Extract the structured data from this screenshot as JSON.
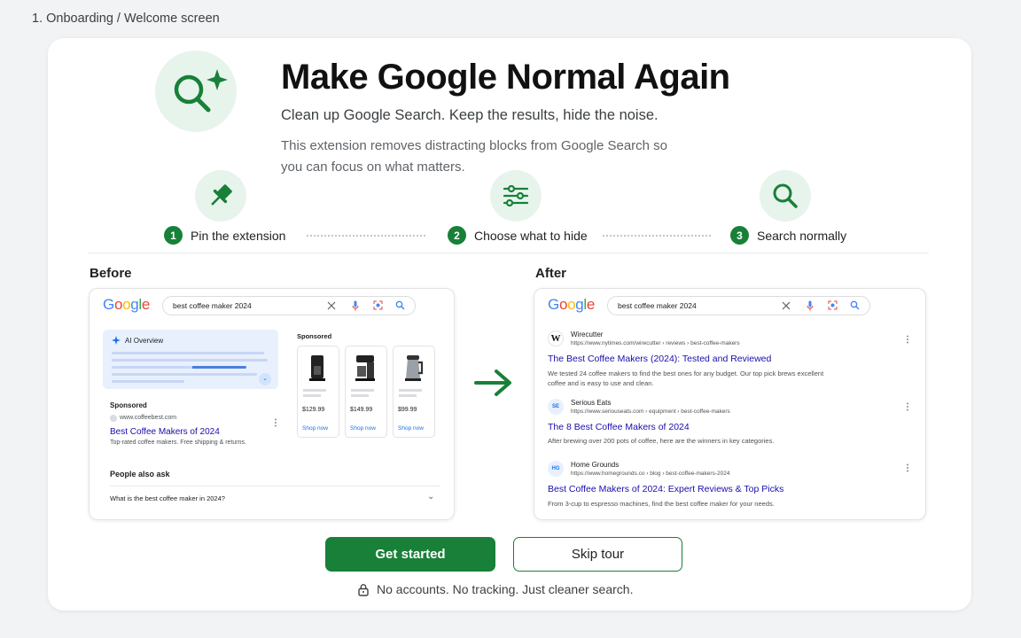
{
  "screen_label": "1. Onboarding / Welcome screen",
  "hero": {
    "title": "Make Google Normal Again",
    "subtitle": "Clean up Google Search. Keep the results, hide the noise.",
    "description": "This extension removes distracting blocks from Google Search so you can focus on what matters.",
    "icon": "search-sparkle-icon"
  },
  "steps": [
    {
      "number": "1",
      "label": "Pin the extension",
      "icon": "pin-icon"
    },
    {
      "number": "2",
      "label": "Choose what to hide",
      "icon": "sliders-icon"
    },
    {
      "number": "3",
      "label": "Search normally",
      "icon": "search-icon"
    }
  ],
  "before": {
    "label": "Before",
    "query": "best coffee maker 2024",
    "ai_overview_label": "AI Overview",
    "sponsored_label": "Sponsored",
    "ad": {
      "sponsored": "Sponsored",
      "url": "www.coffeebest.com",
      "title": "Best Coffee Makers of 2024",
      "snippet": "Top-rated coffee makers. Free shipping & returns."
    },
    "products": [
      {
        "price": "$129.99",
        "cta": "Shop now"
      },
      {
        "price": "$149.99",
        "cta": "Shop now"
      },
      {
        "price": "$99.99",
        "cta": "Shop now"
      }
    ],
    "paa_title": "People also ask",
    "paa_question": "What is the best coffee maker in 2024?"
  },
  "after": {
    "label": "After",
    "query": "best coffee maker 2024",
    "results": [
      {
        "site": "Wirecutter",
        "favicon": "W",
        "url": "https://www.nytimes.com/wirecutter › reviews › best-coffee-makers",
        "title": "The Best Coffee Makers (2024): Tested and Reviewed",
        "snippet": "We tested 24 coffee makers to find the best ones for any budget. Our top pick brews excellent coffee and is easy to use and clean."
      },
      {
        "site": "Serious Eats",
        "favicon": "SE",
        "url": "https://www.seriouseats.com › equipment › best-coffee-makers",
        "title": "The 8 Best Coffee Makers of 2024",
        "snippet": "After brewing over 200 pots of coffee, here are the winners in key categories."
      },
      {
        "site": "Home Grounds",
        "favicon": "HG",
        "url": "https://www.homegrounds.co › blog › best-coffee-makers-2024",
        "title": "Best Coffee Makers of 2024: Expert Reviews & Top Picks",
        "snippet": "From 3-cup to espresso machines, find the best coffee maker for your needs."
      }
    ]
  },
  "buttons": {
    "primary": "Get started",
    "secondary": "Skip tour"
  },
  "privacy_note": "No accounts. No tracking. Just cleaner search.",
  "colors": {
    "accent": "#188038",
    "accent_light": "#e7f4ec",
    "link": "#1a0dab"
  }
}
